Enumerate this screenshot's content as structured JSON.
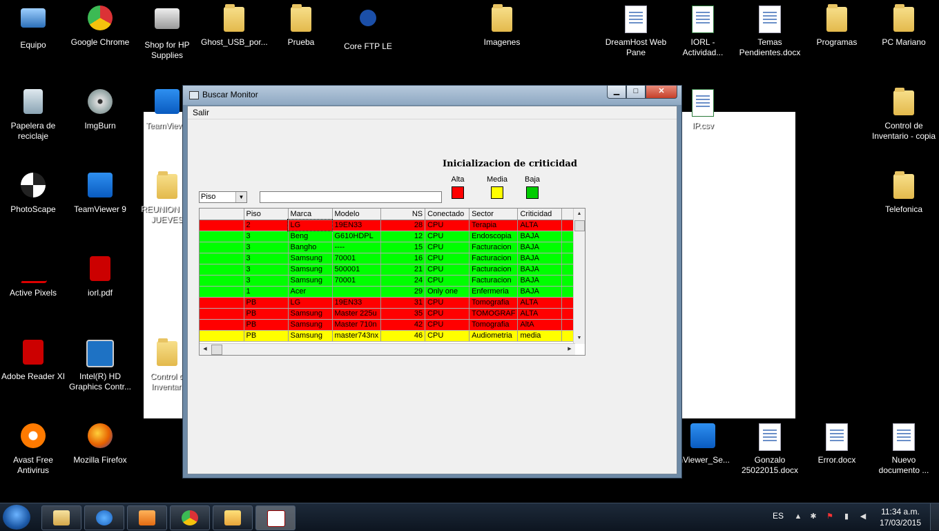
{
  "desktop": {
    "icons": [
      {
        "label": "Equipo"
      },
      {
        "label": "Google Chrome"
      },
      {
        "label": "Shop for HP Supplies"
      },
      {
        "label": "Ghost_USB_por..."
      },
      {
        "label": "Prueba"
      },
      {
        "label": "Core FTP LE"
      },
      {
        "label": "Imagenes"
      },
      {
        "label": "DreamHost  Web Pane"
      },
      {
        "label": "IORL - Actividad..."
      },
      {
        "label": "Temas Pendientes.docx"
      },
      {
        "label": "Programas"
      },
      {
        "label": "PC Mariano"
      },
      {
        "label": "Papelera de reciclaje"
      },
      {
        "label": "ImgBurn"
      },
      {
        "label": "TeamViewe"
      },
      {
        "label": "IP.csv"
      },
      {
        "label": "Control de Inventario - copia"
      },
      {
        "label": "PhotoScape"
      },
      {
        "label": "TeamViewer 9"
      },
      {
        "label": "REUNION DE JUEVES"
      },
      {
        "label": "Telefonica"
      },
      {
        "label": "Active Pixels"
      },
      {
        "label": "iorl.pdf"
      },
      {
        "label": "Adobe Reader XI"
      },
      {
        "label": "Intel(R) HD Graphics Contr..."
      },
      {
        "label": "Control d Inventari"
      },
      {
        "label": "Avast Free Antivirus"
      },
      {
        "label": "Mozilla Firefox"
      },
      {
        "label": "mViewer_Se..."
      },
      {
        "label": "Gonzalo 25022015.docx"
      },
      {
        "label": "Error.docx"
      },
      {
        "label": "Nuevo documento ..."
      }
    ]
  },
  "window": {
    "title": "Buscar Monitor",
    "menu": {
      "salir": "Salir"
    },
    "buttons": {
      "minimize": "▁",
      "maximize": "□",
      "close": "✕"
    },
    "criticidad": {
      "title": "Inicializacion de criticidad",
      "legend": [
        {
          "label": "Alta",
          "color": "#ff0000"
        },
        {
          "label": "Media",
          "color": "#ffff00"
        },
        {
          "label": "Baja",
          "color": "#00cc00"
        }
      ]
    },
    "filter": {
      "combo_value": "Piso",
      "text_value": ""
    },
    "grid": {
      "columns": [
        "",
        "Piso",
        "Marca",
        "Modelo",
        "NS",
        "Conectado",
        "Sector",
        "Criticidad",
        ""
      ],
      "rows": [
        {
          "cls": "red",
          "cells": [
            "",
            "2",
            "LG",
            "19EN33",
            "28",
            "CPU",
            "Terapia",
            "ALTA",
            ""
          ]
        },
        {
          "cls": "green",
          "cells": [
            "",
            "3",
            "Beng",
            "G610HDPL",
            "12",
            "CPU",
            "Endoscopia",
            "BAJA",
            ""
          ]
        },
        {
          "cls": "green",
          "cells": [
            "",
            "3",
            "Bangho",
            "----",
            "15",
            "CPU",
            "Facturacion",
            "BAJA",
            ""
          ]
        },
        {
          "cls": "green",
          "cells": [
            "",
            "3",
            "Samsung",
            "70001",
            "16",
            "CPU",
            "Facturacion",
            "BAJA",
            ""
          ]
        },
        {
          "cls": "green",
          "cells": [
            "",
            "3",
            "Samsung",
            "500001",
            "21",
            "CPU",
            "Facturacion",
            "BAJA",
            ""
          ]
        },
        {
          "cls": "green",
          "cells": [
            "",
            "3",
            "Samsung",
            "70001",
            "24",
            "CPU",
            "Facturacion",
            "BAJA",
            ""
          ]
        },
        {
          "cls": "green",
          "cells": [
            "",
            "1",
            "Acer",
            "",
            "29",
            " Only one",
            "Enfermeria",
            "BAJA",
            ""
          ]
        },
        {
          "cls": "red",
          "cells": [
            "",
            "PB",
            "LG",
            "19EN33",
            "31",
            "CPU",
            "Tomografia",
            "ALTA",
            ""
          ]
        },
        {
          "cls": "red",
          "cells": [
            "",
            "PB",
            "Samsung",
            "Master 225u",
            "35",
            "CPU",
            "TOMOGRAF",
            "ALTA",
            ""
          ]
        },
        {
          "cls": "red",
          "cells": [
            "",
            "PB",
            "Samsung",
            "Master 710n",
            "42",
            "CPU",
            "Tomografia",
            "AltA",
            ""
          ]
        },
        {
          "cls": "yellow",
          "cells": [
            "",
            "PB",
            "Samsung",
            "master743nx",
            "46",
            "CPU",
            "Audiometria",
            "media",
            ""
          ]
        }
      ]
    }
  },
  "taskbar": {
    "language": "ES",
    "time": "11:34 a.m.",
    "date": "17/03/2015"
  }
}
